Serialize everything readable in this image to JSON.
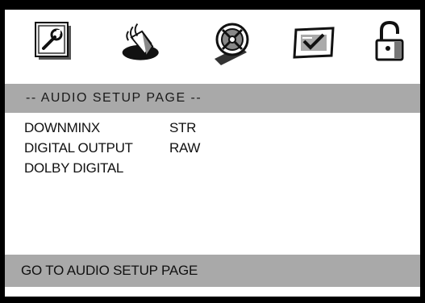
{
  "tabs": [
    {
      "icon": "general-setup-icon"
    },
    {
      "icon": "audio-speaker-icon"
    },
    {
      "icon": "video-film-icon"
    },
    {
      "icon": "preference-check-icon"
    },
    {
      "icon": "lock-icon"
    }
  ],
  "header": {
    "title": "-- AUDIO SETUP PAGE --"
  },
  "items": [
    {
      "label": "DOWNMINX",
      "value": "STR"
    },
    {
      "label": "DIGITAL OUTPUT",
      "value": "RAW"
    },
    {
      "label": "DOLBY DIGITAL",
      "value": ""
    }
  ],
  "status": {
    "text": "GO TO AUDIO SETUP PAGE"
  },
  "colors": {
    "band": "#a9a9a9",
    "frame": "#000000",
    "background": "#ffffff"
  }
}
